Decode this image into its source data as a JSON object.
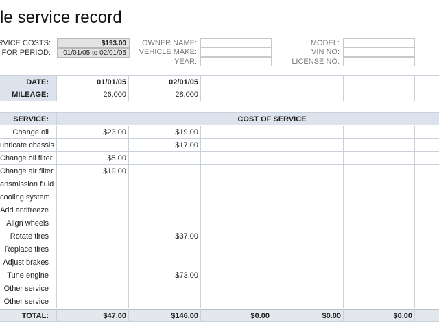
{
  "title": "le service record",
  "summary": {
    "service_costs_label": "ERVICE COSTS:",
    "service_costs_value": "$193.00",
    "period_label": "FOR PERIOD:",
    "period_value": "01/01/05 to 02/01/05"
  },
  "vehicle": {
    "owner_name_label": "OWNER NAME:",
    "vehicle_make_label": "VEHICLE MAKE:",
    "year_label": "YEAR:",
    "model_label": "MODEL:",
    "vin_label": "VIN NO:",
    "license_label": "LICENSE NO:"
  },
  "dates": {
    "label": "DATE:",
    "values": [
      "01/01/05",
      "02/01/05",
      "",
      "",
      "",
      ""
    ]
  },
  "mileage": {
    "label": "MILEAGE:",
    "values": [
      "26,000",
      "28,000",
      "",
      "",
      "",
      ""
    ]
  },
  "services_header": {
    "service_label": "SERVICE:",
    "cost_label": "COST OF SERVICE"
  },
  "services": [
    {
      "name": "Change oil",
      "costs": [
        "$23.00",
        "$19.00",
        "",
        "",
        "",
        ""
      ]
    },
    {
      "name": "ubricate chassis",
      "costs": [
        "",
        "$17.00",
        "",
        "",
        "",
        ""
      ]
    },
    {
      "name": "Change oil filter",
      "costs": [
        "$5.00",
        "",
        "",
        "",
        "",
        ""
      ]
    },
    {
      "name": "Change air filter",
      "costs": [
        "$19.00",
        "",
        "",
        "",
        "",
        ""
      ]
    },
    {
      "name": "ansmission fluid",
      "costs": [
        "",
        "",
        "",
        "",
        "",
        ""
      ]
    },
    {
      "name": "cooling system",
      "costs": [
        "",
        "",
        "",
        "",
        "",
        ""
      ]
    },
    {
      "name": "Add antifreeze",
      "costs": [
        "",
        "",
        "",
        "",
        "",
        ""
      ]
    },
    {
      "name": "Align wheels",
      "costs": [
        "",
        "",
        "",
        "",
        "",
        ""
      ]
    },
    {
      "name": "Rotate tires",
      "costs": [
        "",
        "$37.00",
        "",
        "",
        "",
        ""
      ]
    },
    {
      "name": "Replace tires",
      "costs": [
        "",
        "",
        "",
        "",
        "",
        ""
      ]
    },
    {
      "name": "Adjust brakes",
      "costs": [
        "",
        "",
        "",
        "",
        "",
        ""
      ]
    },
    {
      "name": "Tune engine",
      "costs": [
        "",
        "$73.00",
        "",
        "",
        "",
        ""
      ]
    },
    {
      "name": "Other service",
      "costs": [
        "",
        "",
        "",
        "",
        "",
        ""
      ]
    },
    {
      "name": "Other service",
      "costs": [
        "",
        "",
        "",
        "",
        "",
        ""
      ]
    }
  ],
  "totals": {
    "label": "TOTAL:",
    "values": [
      "$47.00",
      "$146.00",
      "$0.00",
      "$0.00",
      "$0.00",
      ""
    ]
  }
}
